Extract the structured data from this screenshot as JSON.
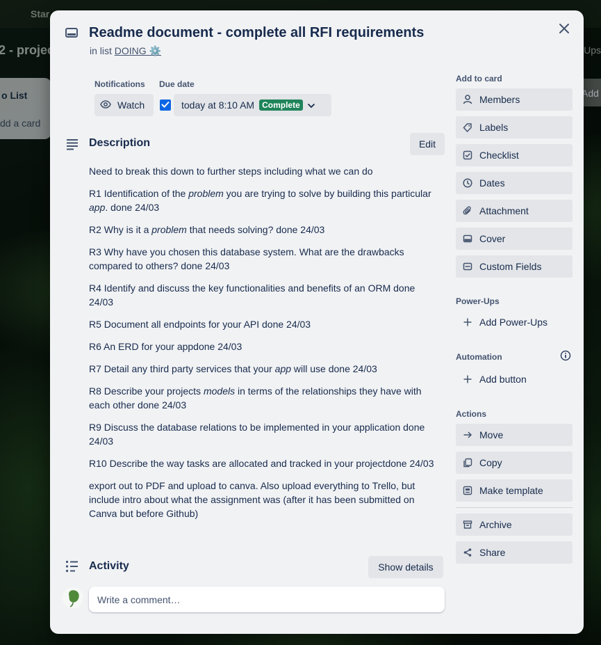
{
  "board": {
    "topbar_label": "Star",
    "title": "2 - projec",
    "ups_label": "Ups",
    "list_title": "o List",
    "add_card": "dd a card",
    "add_label": "Add"
  },
  "card": {
    "title": "Readme document - complete all RFI requirements",
    "in_list_prefix": "in list",
    "list_name": "DOING ⚙️"
  },
  "notifications": {
    "label": "Notifications",
    "watch_label": "Watch"
  },
  "due": {
    "label": "Due date",
    "value": "today at 8:10 AM",
    "status": "Complete",
    "checked": true
  },
  "description": {
    "title": "Description",
    "edit_label": "Edit",
    "paragraphs": [
      [
        {
          "t": "Need to break this down to further steps including what we can do"
        }
      ],
      [
        {
          "t": "R1 Identification of the "
        },
        {
          "t": "problem",
          "i": true
        },
        {
          "t": " you are trying to solve by building this particular "
        },
        {
          "t": "app",
          "i": true
        },
        {
          "t": ". done 24/03"
        }
      ],
      [
        {
          "t": "R2 Why is it a "
        },
        {
          "t": "problem",
          "i": true
        },
        {
          "t": " that needs solving? done 24/03"
        }
      ],
      [
        {
          "t": "R3 Why have you chosen this database system. What are the drawbacks compared to others? done 24/03"
        }
      ],
      [
        {
          "t": "R4 Identify and discuss the key functionalities and benefits of an ORM done 24/03"
        }
      ],
      [
        {
          "t": "R5 Document all endpoints for your API done 24/03"
        }
      ],
      [
        {
          "t": "R6 An ERD for your appdone 24/03"
        }
      ],
      [
        {
          "t": "R7 Detail any third party services that your "
        },
        {
          "t": "app",
          "i": true
        },
        {
          "t": " will use done 24/03"
        }
      ],
      [
        {
          "t": "R8 Describe your projects "
        },
        {
          "t": "models",
          "i": true
        },
        {
          "t": " in terms of the relationships they have with each other done 24/03"
        }
      ],
      [
        {
          "t": "R9 Discuss the database relations to be implemented in your application done 24/03"
        }
      ],
      [
        {
          "t": "R10 Describe the way tasks are allocated and tracked in your projectdone 24/03"
        }
      ],
      [
        {
          "t": "export out to PDF and upload to canva. Also upload everything to Trello, but include intro about what the assignment was (after it has been submitted on Canva but before Github)"
        }
      ]
    ]
  },
  "activity": {
    "title": "Activity",
    "show_details_label": "Show details",
    "comment_placeholder": "Write a comment…"
  },
  "sidebar": {
    "add_to_card_label": "Add to card",
    "add_to_card": [
      {
        "label": "Members",
        "icon": "person-icon"
      },
      {
        "label": "Labels",
        "icon": "tag-icon"
      },
      {
        "label": "Checklist",
        "icon": "checkbox-icon"
      },
      {
        "label": "Dates",
        "icon": "clock-icon"
      },
      {
        "label": "Attachment",
        "icon": "paperclip-icon"
      },
      {
        "label": "Cover",
        "icon": "card-cover-icon"
      },
      {
        "label": "Custom Fields",
        "icon": "custom-fields-icon"
      }
    ],
    "power_ups_label": "Power-Ups",
    "add_power_ups": "Add Power-Ups",
    "automation_label": "Automation",
    "add_button": "Add button",
    "actions_label": "Actions",
    "actions": [
      {
        "label": "Move",
        "icon": "arrow-right-icon"
      },
      {
        "label": "Copy",
        "icon": "copy-icon"
      },
      {
        "label": "Make template",
        "icon": "template-icon"
      },
      {
        "label": "Archive",
        "icon": "archive-icon"
      },
      {
        "label": "Share",
        "icon": "share-icon"
      }
    ]
  },
  "colors": {
    "accent": "#0c66e4",
    "complete_badge": "#1f845a",
    "modal_bg": "#f1f2f4",
    "button_bg": "#e3e5e8"
  }
}
